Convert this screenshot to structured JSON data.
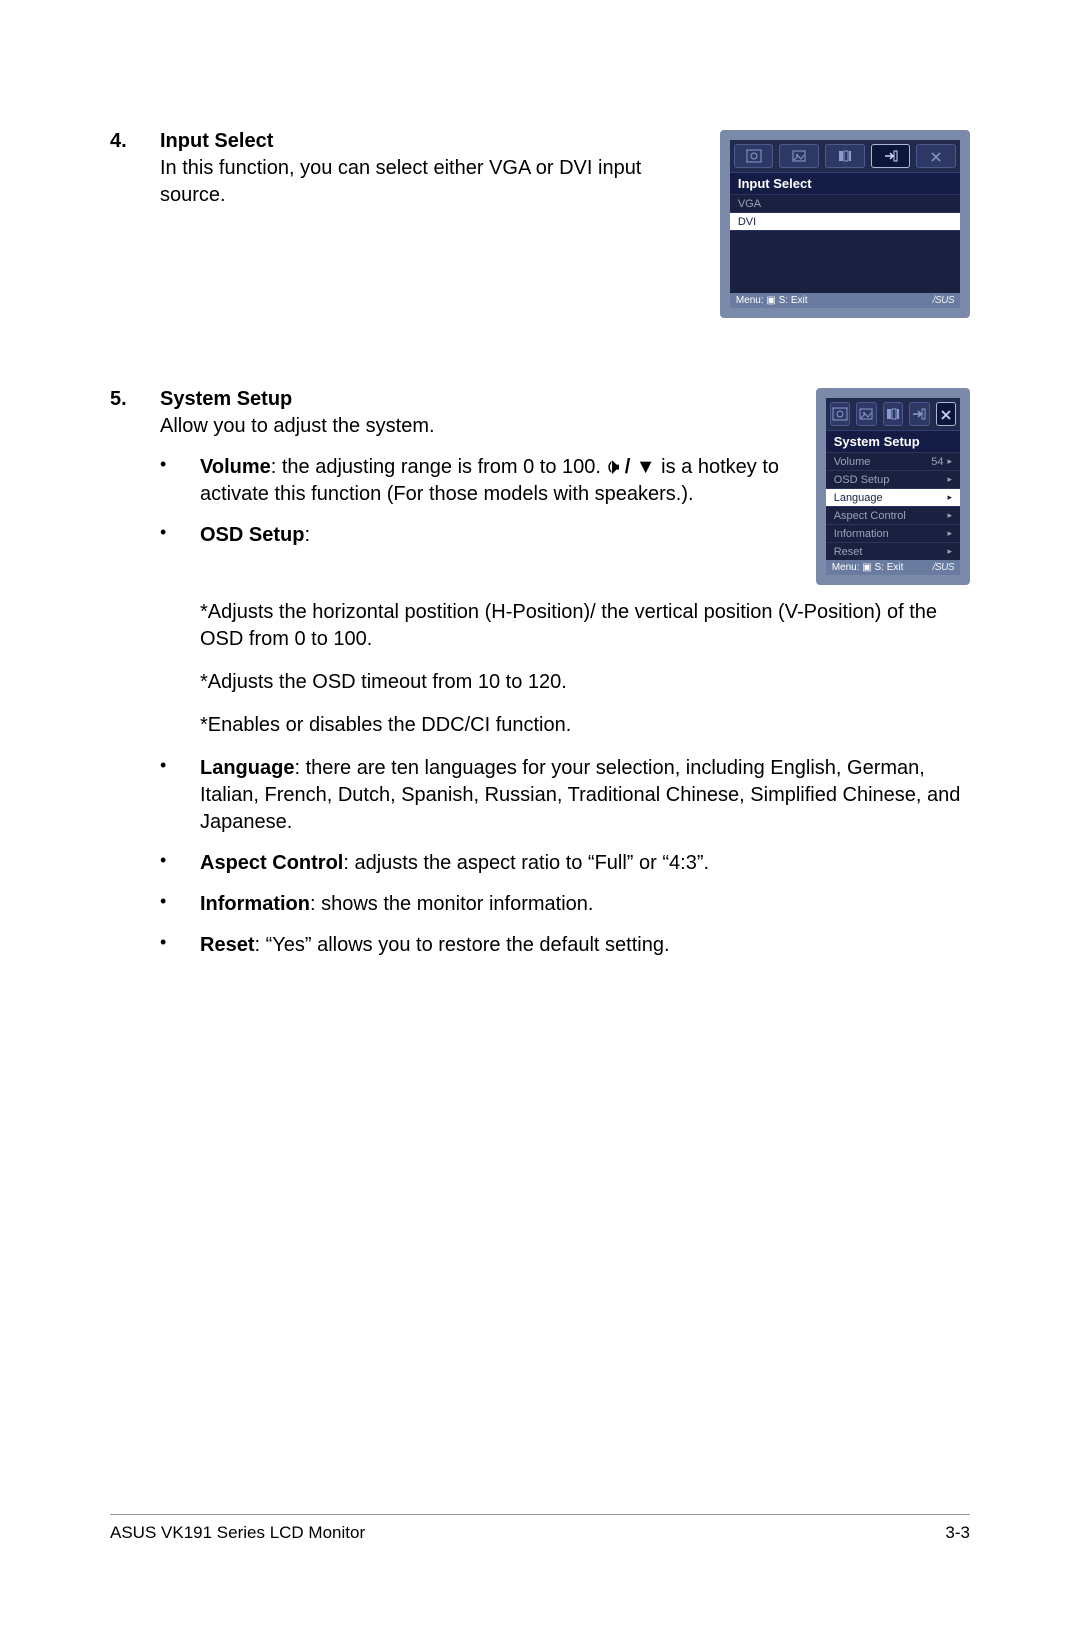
{
  "section4": {
    "num": "4.",
    "title": "Input Select",
    "para": "In this function, you can select either VGA or DVI input source."
  },
  "osd1": {
    "title": "Input Select",
    "items": [
      {
        "label": "VGA"
      },
      {
        "label": "DVI",
        "selected": true
      }
    ],
    "footer_left": "Menu: ▣   S: Exit",
    "footer_right": "/SUS"
  },
  "section5": {
    "num": "5.",
    "title": "System Setup",
    "para": "Allow you to adjust the system."
  },
  "osd2": {
    "title": "System Setup",
    "items": [
      {
        "label": "Volume",
        "value": "54"
      },
      {
        "label": "OSD Setup"
      },
      {
        "label": "Language",
        "selected": true
      },
      {
        "label": "Aspect Control"
      },
      {
        "label": "Information"
      },
      {
        "label": "Reset"
      }
    ],
    "footer_left": "Menu: ▣   S: Exit",
    "footer_right": "/SUS"
  },
  "bullets": {
    "volume": {
      "label": "Volume",
      "before": ": the adjusting range is from 0 to 100. ",
      "after": " is a hotkey to activate this function (For those models with speakers.)."
    },
    "osd_setup": {
      "label": "OSD Setup",
      "colon": ":",
      "s1": "*Adjusts the horizontal postition (H-Position)/ the vertical position (V-Position) of the OSD from 0 to 100.",
      "s2": "*Adjusts the OSD timeout from 10 to 120.",
      "s3": "*Enables or disables the DDC/CI function."
    },
    "language": {
      "label": "Language",
      "text": ": there are ten languages for your selection, including English, German, Italian, French, Dutch, Spanish, Russian, Traditional Chinese, Simplified Chinese, and Japanese."
    },
    "aspect": {
      "label": "Aspect Control",
      "text": ": adjusts the aspect ratio to “Full” or “4:3”."
    },
    "info": {
      "label": "Information",
      "text": ": shows the monitor information."
    },
    "reset": {
      "label": "Reset",
      "text": ": “Yes” allows you to restore the default setting."
    }
  },
  "footer": {
    "left": "ASUS VK191 Series LCD Monitor",
    "right": "3-3"
  }
}
